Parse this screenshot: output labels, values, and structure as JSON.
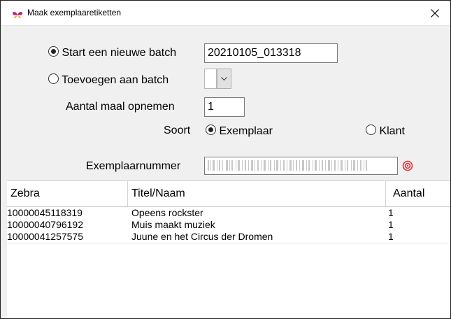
{
  "window": {
    "title": "Maak exemplaaretiketten"
  },
  "batch": {
    "new_label": "Start een nieuwe batch",
    "new_value": "20210105_013318",
    "add_label": "Toevoegen aan batch"
  },
  "copies": {
    "label": "Aantal maal opnemen",
    "value": "1"
  },
  "kind": {
    "label": "Soort",
    "option_copy": "Exemplaar",
    "option_customer": "Klant",
    "selected": "Exemplaar"
  },
  "scan": {
    "label": "Exemplaarnummer"
  },
  "grid": {
    "columns": [
      "Zebra",
      "Titel/Naam",
      "Aantal"
    ],
    "rows": [
      {
        "zebra": "10000045118319",
        "title": "Opeens rockster",
        "count": "1"
      },
      {
        "zebra": "10000040796192",
        "title": "Muis maakt muziek",
        "count": "1"
      },
      {
        "zebra": "10000041257575",
        "title": "Juune en het Circus der Dromen",
        "count": "1"
      }
    ]
  },
  "icons": {
    "app": "butterfly-icon",
    "close": "close-icon",
    "dropdown": "chevron-down-icon",
    "scan": "target-icon"
  },
  "colors": {
    "accent": "#e8323c",
    "app_icon": "#c0207a"
  }
}
